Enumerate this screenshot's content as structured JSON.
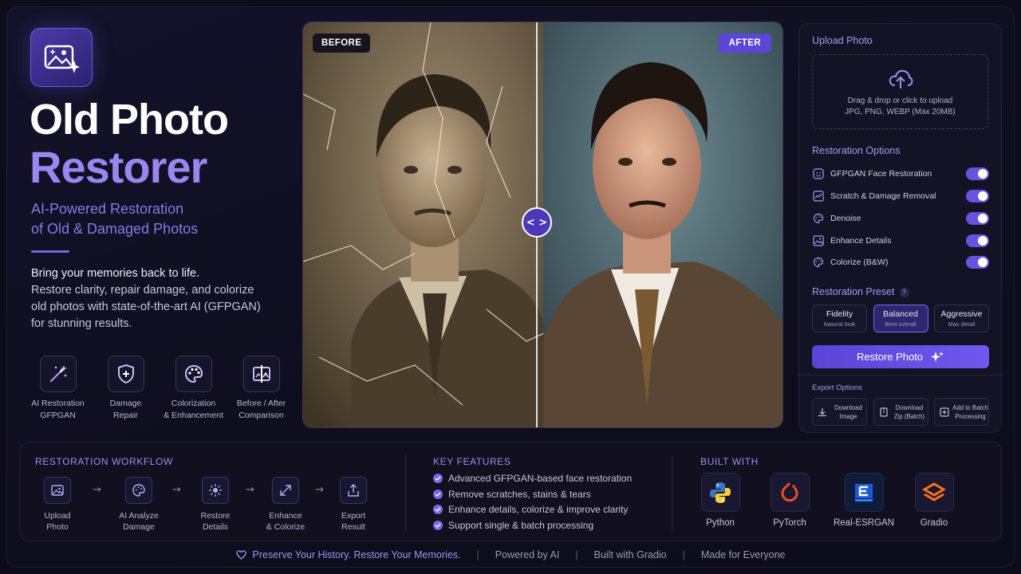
{
  "hero": {
    "title_line1": "Old Photo",
    "title_line2": "Restorer",
    "subtitle_line1": "AI-Powered Restoration",
    "subtitle_line2": "of Old & Damaged Photos",
    "desc_lead": "Bring your memories back to life.",
    "desc_body": "Restore clarity, repair damage, and colorize old photos with state-of-the-art AI (GFPGAN) for stunning results.",
    "features": [
      {
        "line1": "AI Restoration",
        "line2": "GFPGAN"
      },
      {
        "line1": "Damage",
        "line2": "Repair"
      },
      {
        "line1": "Colorization",
        "line2": "& Enhancement"
      },
      {
        "line1": "Before / After",
        "line2": "Comparison"
      }
    ]
  },
  "compare": {
    "before_label": "BEFORE",
    "after_label": "AFTER",
    "split": 0.485
  },
  "panel": {
    "upload_title": "Upload Photo",
    "upload_line1": "Drag & drop or click to upload",
    "upload_line2": "JPG, PNG, WEBP (Max 20MB)",
    "options_title": "Restoration Options",
    "options": [
      {
        "label": "GFPGAN Face Restoration",
        "enabled": true
      },
      {
        "label": "Scratch & Damage Removal",
        "enabled": true
      },
      {
        "label": "Denoise",
        "enabled": true
      },
      {
        "label": "Enhance Details",
        "enabled": true
      },
      {
        "label": "Colorize (B&W)",
        "enabled": true
      }
    ],
    "preset_title": "Restoration Preset",
    "preset_help": "?",
    "presets": [
      {
        "name": "Fidelity",
        "sub": "Natural look",
        "active": false
      },
      {
        "name": "Balanced",
        "sub": "Best overall",
        "active": true
      },
      {
        "name": "Aggressive",
        "sub": "Max detail",
        "active": false
      }
    ],
    "restore_label": "Restore Photo",
    "export_title": "Export Options",
    "exports": [
      {
        "line1": "Download",
        "line2": "Image"
      },
      {
        "line1": "Download",
        "line2": "Zip (Batch)"
      },
      {
        "line1": "Add to Batch",
        "line2": "Processing"
      }
    ]
  },
  "workflow": {
    "title": "RESTORATION WORKFLOW",
    "steps": [
      {
        "line1": "Upload",
        "line2": "Photo"
      },
      {
        "line1": "AI Analyze",
        "line2": "Damage"
      },
      {
        "line1": "Restore",
        "line2": "Details"
      },
      {
        "line1": "Enhance",
        "line2": "& Colorize"
      },
      {
        "line1": "Export",
        "line2": "Result"
      }
    ],
    "arrow": "→"
  },
  "key_features": {
    "title": "KEY FEATURES",
    "items": [
      "Advanced GFPGAN-based face restoration",
      "Remove scratches, stains & tears",
      "Enhance details, colorize & improve clarity",
      "Support single & batch processing"
    ]
  },
  "built_with": {
    "title": "BUILT WITH",
    "items": [
      "Python",
      "PyTorch",
      "Real-ESRGAN",
      "Gradio"
    ]
  },
  "footer": {
    "tagline": "Preserve Your History. Restore Your Memories.",
    "items": [
      "Powered by AI",
      "Built with Gradio",
      "Made for Everyone"
    ],
    "sep": "|"
  },
  "colors": {
    "accent": "#7058ec",
    "accent_light": "#9a86f0",
    "background": "#0d0c18",
    "panel": "#141225"
  }
}
